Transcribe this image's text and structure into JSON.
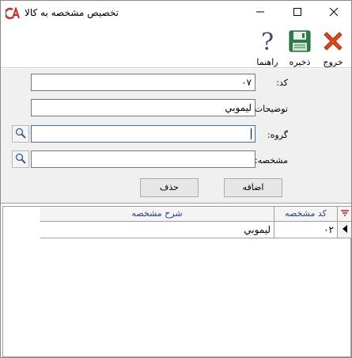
{
  "window": {
    "title": "تخصيص مشخصه به کالا",
    "logo_icon": "app-logo-icon",
    "controls": [
      "minimize-icon",
      "maximize-icon",
      "close-icon"
    ]
  },
  "toolbar": {
    "exit_label": "خروج",
    "save_label": "ذخيره",
    "help_label": "راهنما",
    "exit_icon": "red-x-icon",
    "save_icon": "floppy-disk-icon",
    "help_icon": "question-mark-icon"
  },
  "form": {
    "code_label": "کد:",
    "code_value": "۰۷",
    "description_label": "توضيحات:",
    "description_value": "ليموبي",
    "group_label": "گروه:",
    "group_value": "",
    "attribute_label": "مشخصه:",
    "attribute_value": "",
    "add_label": "اضافه",
    "delete_label": "حذف"
  },
  "grid": {
    "columns": [
      "کد مشخصه",
      "شرح مشخصه"
    ],
    "rows": [
      {
        "code": "۰۲",
        "description": "ليموبي"
      }
    ]
  },
  "colors": {
    "header_text": "#1f3f9a",
    "filter_icon": "#d42020",
    "exit_icon": "#e0461e",
    "save_icon": "#2d7d46"
  }
}
